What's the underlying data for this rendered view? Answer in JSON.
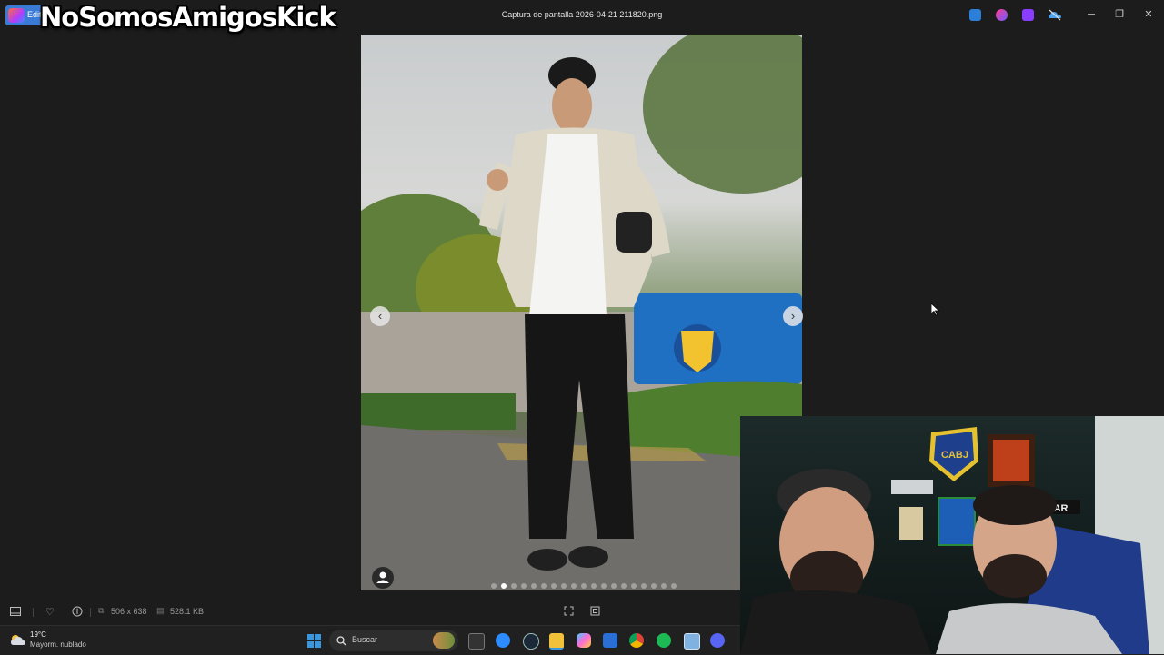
{
  "window": {
    "title": "Captura de pantalla 2026-04-21 211820.png",
    "badge_text": "Edit",
    "minimize": "─",
    "maximize": "❐",
    "close": "✕"
  },
  "overlay": {
    "watermark": "NoSomosAmigosKick"
  },
  "viewer": {
    "prev_arrow": "‹",
    "next_arrow": "›",
    "dot_count": 19,
    "active_dot": 1
  },
  "info_bar": {
    "dimensions": "506 x 638",
    "file_size": "528.1 KB"
  },
  "taskbar": {
    "weather_temp": "19°C",
    "weather_desc": "Mayorm. nublado",
    "search_placeholder": "Buscar"
  },
  "colors": {
    "background": "#1c1c1c",
    "taskbar": "#202020",
    "windows_blue": "#3a96dd"
  },
  "webcam_signs": {
    "crest": "CABJ",
    "banner": "ESDAR"
  }
}
